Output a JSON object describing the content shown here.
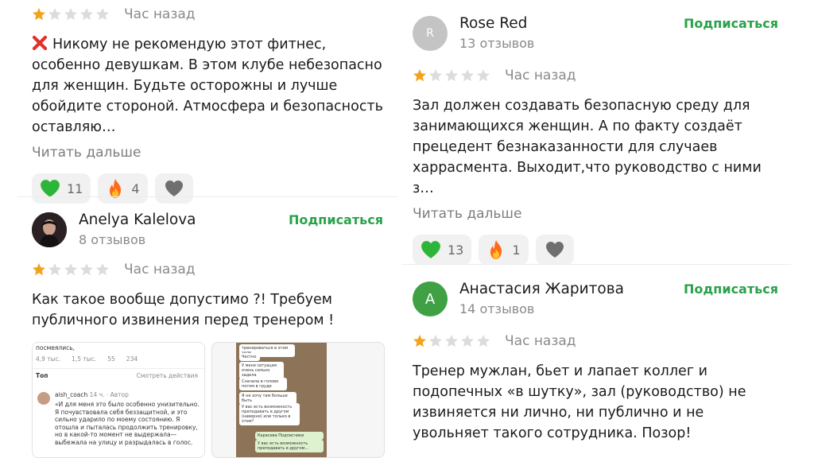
{
  "colors": {
    "star_active": "#f2a31d",
    "star_inactive": "#dcdcdc",
    "subscribe": "#2aa24a",
    "like": "#2db53a",
    "fire": "#ff6a1a"
  },
  "left": {
    "review1": {
      "rating": 1,
      "time": "Час назад",
      "icon": "cross-mark-icon",
      "text": "Никому не рекомендую этот фитнес, особенно девушкам. В этом клубе небезопасно для женщин. Будьте осторожны и лучше обойдите стороной. Атмосфера и безопасность оставляю…",
      "read_more": "Читать дальше",
      "reactions": {
        "like": "11",
        "fire": "4"
      }
    },
    "review2": {
      "author": "Anelya Kalelova",
      "count": "8 отзывов",
      "subscribe": "Подписаться",
      "rating": 1,
      "time": "Час назад",
      "text": "Как такое вообще допустимо ?! Требуем публичного извинения перед тренером !",
      "thumb1": {
        "line1": "посмеялись,",
        "stats": [
          "4,9 тыс.",
          "1,5 тыс.",
          "55",
          "234"
        ],
        "top_label": "Топ",
        "actions": "Смотреть действия",
        "user": "aish_coach",
        "user_meta": "14 ч. · Автор",
        "quote": "«И для меня это было особенно унизительно. Я почувствовала себя беззащитной, и это сильно ударило по моему состоянию. Я отошла и пыталась продолжить тренировку, но в какой-то момент не выдержала— выбежала на улицу и разрыдалась в голос."
      },
      "thumb2": {
        "msgs": [
          "тренироваться в этом зале",
          "Честно",
          "У меня ситуация очень сильно задела",
          "Сначала в голове потом в груди",
          "Я не хочу там больше быть",
          "У вас есть возможность преподавать в другом (наверно) или только в этом?",
          "Карасева Подписчики",
          "У вас есть возможность преподавать в другом..."
        ]
      }
    }
  },
  "right": {
    "review1": {
      "author": "Rose Red",
      "avatar_letter": "R",
      "count": "13 отзывов",
      "subscribe": "Подписаться",
      "rating": 1,
      "time": "Час назад",
      "text": "Зал должен создавать безопасную среду для занимающихся женщин. А по факту создаёт прецедент безнаказанности для случаев харрасмента. Выходит,что руководство с ними з…",
      "read_more": "Читать дальше",
      "reactions": {
        "like": "13",
        "fire": "1"
      }
    },
    "review2": {
      "author": "Анастасия Жаритова",
      "avatar_letter": "А",
      "count": "14 отзывов",
      "subscribe": "Подписаться",
      "rating": 1,
      "time": "Час назад",
      "text": "Тренер мужлан, бьет и лапает коллег и подопечных «в шутку», зал (руководство) не извиняется ни лично, ни публично и не увольняет такого сотрудника. Позор!"
    }
  }
}
